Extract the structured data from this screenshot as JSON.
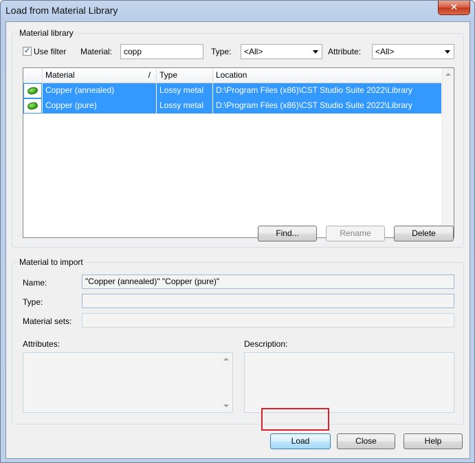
{
  "window": {
    "title": "Load from Material Library",
    "close_glyph": "✕"
  },
  "library_group": {
    "label": "Material library",
    "use_filter_label": "Use filter",
    "use_filter_checked": true,
    "checkmark": "✓",
    "material_label": "Material:",
    "material_value": "copp",
    "type_label": "Type:",
    "type_value": "<All>",
    "attribute_label": "Attribute:",
    "attribute_value": "<All>"
  },
  "table": {
    "columns": [
      "Material",
      "Type",
      "Location"
    ],
    "sort_indicator": "/",
    "rows": [
      {
        "material": "Copper (annealed)",
        "type": "Lossy metal",
        "location": "D:\\Program Files (x86)\\CST Studio Suite 2022\\Library",
        "icon": "material-brick-icon",
        "selected": true
      },
      {
        "material": "Copper (pure)",
        "type": "Lossy metal",
        "location": "D:\\Program Files (x86)\\CST Studio Suite 2022\\Library",
        "icon": "material-brick-icon",
        "selected": true
      }
    ]
  },
  "library_buttons": {
    "find": "Find...",
    "rename": "Rename",
    "delete": "Delete"
  },
  "import_group": {
    "label": "Material to import",
    "name_label": "Name:",
    "name_value": "\"Copper (annealed)\" \"Copper (pure)\"",
    "type_label": "Type:",
    "type_value": "",
    "material_sets_label": "Material sets:",
    "material_sets_value": "",
    "attributes_label": "Attributes:",
    "description_label": "Description:"
  },
  "footer": {
    "load": "Load",
    "close": "Close",
    "help": "Help"
  },
  "colors": {
    "selection": "#3399ff",
    "highlight_border": "#d9222a"
  }
}
